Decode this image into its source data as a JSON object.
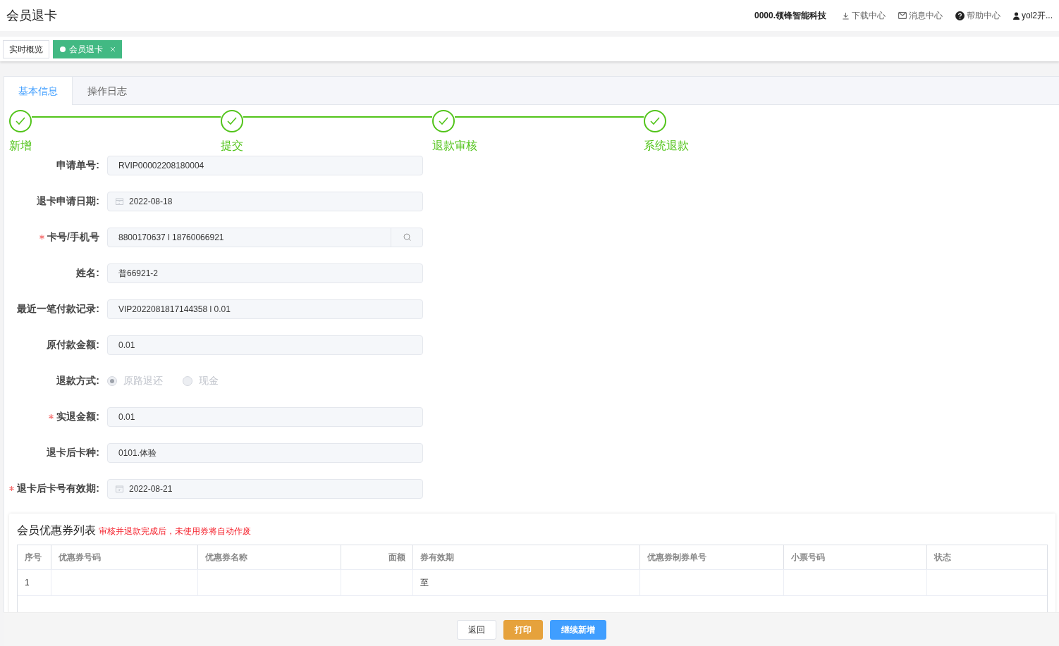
{
  "header": {
    "title": "会员退卡",
    "company": "0000.领锋智能科技",
    "links": [
      {
        "kind": "download",
        "label": "下载中心"
      },
      {
        "kind": "mail",
        "label": "消息中心"
      },
      {
        "kind": "help",
        "label": "帮助中心"
      },
      {
        "kind": "user",
        "label": "yol2开..."
      }
    ]
  },
  "page_tabs": [
    {
      "label": "实时概览",
      "selected": false
    },
    {
      "label": "会员退卡",
      "selected": true,
      "closable": true
    }
  ],
  "tabs": [
    {
      "label": "基本信息",
      "selected": true
    },
    {
      "label": "操作日志",
      "selected": false
    }
  ],
  "steps": [
    {
      "label": "新增",
      "done": true
    },
    {
      "label": "提交",
      "done": true
    },
    {
      "label": "退款审核",
      "done": true
    },
    {
      "label": "系统退款",
      "done": true
    }
  ],
  "form": [
    {
      "kind": "text",
      "label": "申请单号:",
      "required": false,
      "value": "RVIP00002208180004"
    },
    {
      "kind": "date",
      "label": "退卡申请日期:",
      "required": false,
      "value": "2022-08-18"
    },
    {
      "kind": "search",
      "label": "卡号/手机号",
      "required": true,
      "value": "8800170637 l 18760066921"
    },
    {
      "kind": "text",
      "label": "姓名:",
      "required": false,
      "value": "普66921-2"
    },
    {
      "kind": "text",
      "label": "最近一笔付款记录:",
      "required": false,
      "value": "VIP2022081817144358 l 0.01"
    },
    {
      "kind": "text",
      "label": "原付款金额:",
      "required": false,
      "value": "0.01"
    },
    {
      "kind": "radio",
      "label": "退款方式:",
      "required": false,
      "options": [
        {
          "label": "原路退还",
          "selected": true,
          "disabled": true
        },
        {
          "label": "现金",
          "selected": false,
          "disabled": true
        }
      ]
    },
    {
      "kind": "text",
      "label": "实退金额:",
      "required": true,
      "value": "0.01"
    },
    {
      "kind": "text",
      "label": "退卡后卡种:",
      "required": false,
      "value": "0101.体验"
    },
    {
      "kind": "date",
      "label": "退卡后卡号有效期:",
      "required": true,
      "value": "2022-08-21"
    }
  ],
  "coupons": {
    "title": "会员优惠券列表",
    "note": "审核并退款完成后，未使用券将自动作废",
    "columns": [
      {
        "label": "序号",
        "kind": "text"
      },
      {
        "label": "优惠券号码",
        "kind": "text"
      },
      {
        "label": "优惠券名称",
        "kind": "text"
      },
      {
        "label": "面额",
        "kind": "amount"
      },
      {
        "label": "券有效期",
        "kind": "text"
      },
      {
        "label": "优惠券制券单号",
        "kind": "text"
      },
      {
        "label": "小票号码",
        "kind": "text"
      },
      {
        "label": "状态",
        "kind": "text"
      }
    ],
    "rows": [
      [
        "1",
        "",
        "",
        "",
        "至",
        "",
        "",
        ""
      ]
    ]
  },
  "buttons": [
    {
      "kind": "default",
      "label": "返回"
    },
    {
      "kind": "warning",
      "label": "打印"
    },
    {
      "kind": "primary",
      "label": "继续新增"
    }
  ]
}
